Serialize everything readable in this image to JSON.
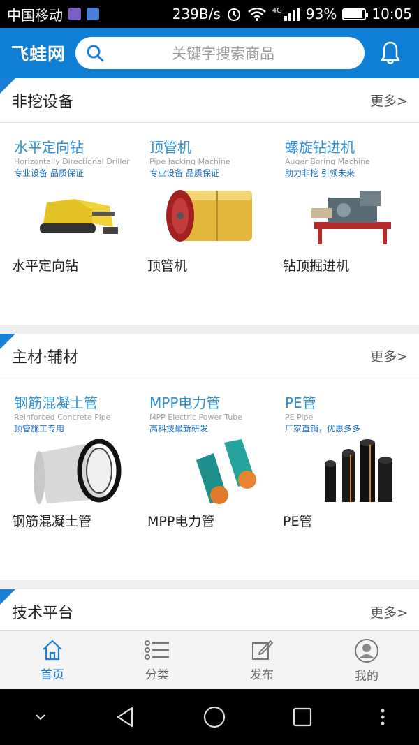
{
  "status": {
    "carrier": "中国移动",
    "net_speed": "239B/s",
    "net_type": "4G",
    "battery": "93%",
    "battery_level": 0.93,
    "time": "10:05"
  },
  "header": {
    "logo": "飞蛙网",
    "search_placeholder": "关键字搜索商品"
  },
  "sections": [
    {
      "title": "非挖设备",
      "more": "更多>",
      "items": [
        {
          "cn": "水平定向钻",
          "en": "Horizontally Directional Driller",
          "tag": "专业设备  品质保证",
          "label": "水平定向钻",
          "icon": "drill-rig-icon"
        },
        {
          "cn": "顶管机",
          "en": "Pipe Jacking Machine",
          "tag": "专业设备  品质保证",
          "label": "顶管机",
          "icon": "pipe-jacking-machine-icon"
        },
        {
          "cn": "螺旋钻进机",
          "en": "Auger Boring Machine",
          "tag": "助力非挖  引领未来",
          "label": "钻顶掘进机",
          "icon": "auger-boring-machine-icon"
        }
      ]
    },
    {
      "title": "主材·辅材",
      "more": "更多>",
      "items": [
        {
          "cn": "钢筋混凝土管",
          "en": "Reinforced Concrete Pipe",
          "tag": "顶管施工专用",
          "label": "钢筋混凝土管",
          "icon": "concrete-pipe-icon"
        },
        {
          "cn": "MPP电力管",
          "en": "MPP Electric Power Tube",
          "tag": "高科技最新研发",
          "label": "MPP电力管",
          "icon": "mpp-pipe-icon"
        },
        {
          "cn": "PE管",
          "en": "PE Pipe",
          "tag": "厂家直销，优惠多多",
          "label": "PE管",
          "icon": "pe-pipe-icon"
        }
      ]
    },
    {
      "title": "技术平台",
      "more": "更多>"
    }
  ],
  "tabs": [
    {
      "label": "首页",
      "icon": "home-icon"
    },
    {
      "label": "分类",
      "icon": "list-icon"
    },
    {
      "label": "发布",
      "icon": "edit-icon"
    },
    {
      "label": "我的",
      "icon": "user-icon"
    }
  ],
  "colors": {
    "primary": "#0f7fd6",
    "accent_text": "#2e8fd6"
  }
}
